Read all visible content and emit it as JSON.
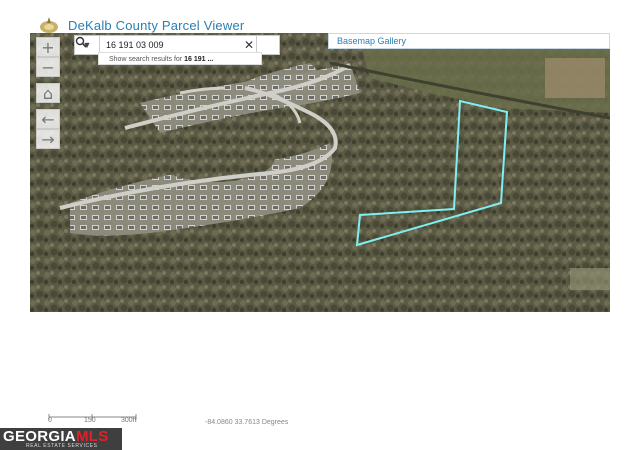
{
  "header": {
    "title": "DeKalb County Parcel Viewer",
    "logo_icon": "dekalb-county-seal-icon"
  },
  "search": {
    "value": "16 191 03 009",
    "dropdown_icon": "caret-down-icon",
    "clear_icon": "close-icon",
    "go_icon": "search-icon",
    "suggestion_prefix": "Show search results for ",
    "suggestion_term": "16 191 ..."
  },
  "basemap": {
    "label": "Basemap Gallery"
  },
  "map_controls": {
    "zoom_in": "+",
    "zoom_out": "−",
    "home": "⌂",
    "back": "←",
    "forward": "→"
  },
  "scale": {
    "labels": [
      "0",
      "150",
      "300ft"
    ]
  },
  "coordinates": "-84.0860 33.7613 Degrees",
  "watermark": {
    "brand_a": "GEORGIA",
    "brand_b": "MLS",
    "tagline": "REAL ESTATE SERVICES"
  },
  "colors": {
    "title_blue": "#2a7fb4",
    "parcel_outline": "#7ff0f0",
    "mls_red": "#e2202a"
  }
}
